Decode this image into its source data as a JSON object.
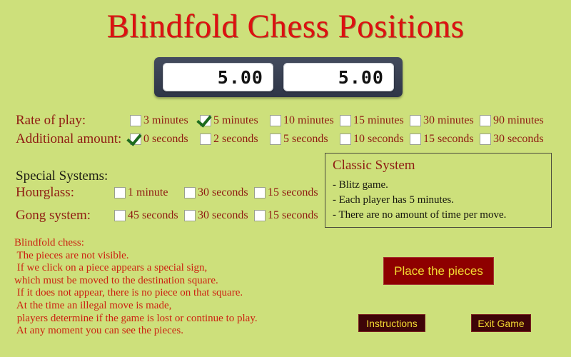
{
  "app": {
    "title": "Blindfold Chess Positions",
    "background_color": "#cde07b",
    "title_color": "#dd1010"
  },
  "clock": {
    "left_display": "5.00",
    "right_display": "5.00",
    "housing_color": "#3a4254"
  },
  "rate_of_play": {
    "label": "Rate of play:",
    "options": [
      {
        "label": "3 minutes",
        "checked": false
      },
      {
        "label": "5 minutes",
        "checked": true
      },
      {
        "label": "10 minutes",
        "checked": false
      },
      {
        "label": "15 minutes",
        "checked": false
      },
      {
        "label": "30 minutes",
        "checked": false
      },
      {
        "label": "90 minutes",
        "checked": false
      }
    ]
  },
  "additional_amount": {
    "label": "Additional amount:",
    "options": [
      {
        "label": "0 seconds",
        "checked": true
      },
      {
        "label": "2 seconds",
        "checked": false
      },
      {
        "label": "5 seconds",
        "checked": false
      },
      {
        "label": "10 seconds",
        "checked": false
      },
      {
        "label": "15 seconds",
        "checked": false
      },
      {
        "label": "30 seconds",
        "checked": false
      }
    ]
  },
  "special_systems": {
    "label": "Special Systems:",
    "hourglass": {
      "label": "Hourglass:",
      "options": [
        {
          "label": "1 minute",
          "checked": false
        },
        {
          "label": "30 seconds",
          "checked": false
        },
        {
          "label": "15 seconds",
          "checked": false
        }
      ]
    },
    "gong": {
      "label": "Gong system:",
      "options": [
        {
          "label": "45 seconds",
          "checked": false
        },
        {
          "label": "30 seconds",
          "checked": false
        },
        {
          "label": "15 seconds",
          "checked": false
        }
      ]
    }
  },
  "classic_system": {
    "title": "Classic System",
    "lines": [
      "- Blitz game.",
      "- Each player has 5 minutes.",
      "- There are no amount of time per move."
    ]
  },
  "blindfold_info": {
    "lines": [
      "Blindfold chess:",
      " The pieces are not visible.",
      " If we click on a piece appears a special sign,",
      "which must be moved to the destination square.",
      " If it does not appear, there is no piece on that square.",
      " At the time an illegal move is made,",
      " players determine if the game is lost or continue to play.",
      " At any moment you can see the pieces."
    ],
    "color": "#cc2211"
  },
  "buttons": {
    "place_pieces": "Place the pieces",
    "instructions": "Instructions",
    "exit_game": "Exit Game",
    "text_color": "#f3d932"
  }
}
